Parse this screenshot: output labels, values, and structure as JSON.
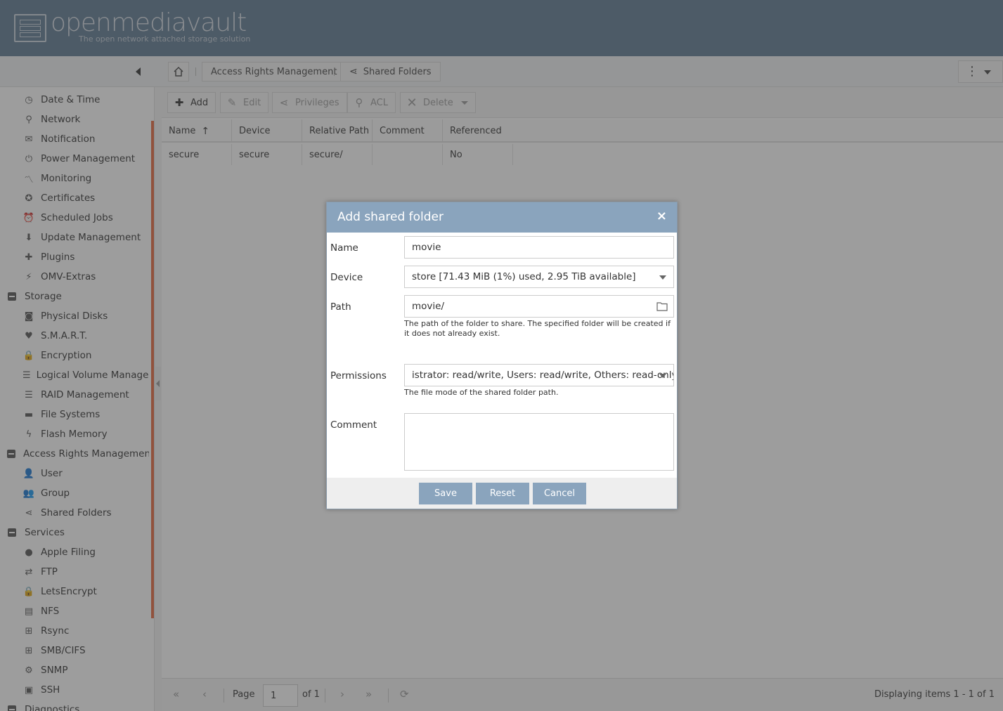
{
  "app": {
    "logo_text": "openmediavault",
    "logo_subtitle": "The open network attached storage solution"
  },
  "breadcrumb": {
    "items": [
      "Access Rights Management",
      "Shared Folders"
    ]
  },
  "sidebar": {
    "items": [
      {
        "label": "Date & Time",
        "icon": "clock-icon",
        "glyph": "◷"
      },
      {
        "label": "Network",
        "icon": "network-icon",
        "glyph": "⚲"
      },
      {
        "label": "Notification",
        "icon": "envelope-icon",
        "glyph": "✉"
      },
      {
        "label": "Power Management",
        "icon": "power-icon",
        "glyph": "⏻"
      },
      {
        "label": "Monitoring",
        "icon": "line-chart-icon",
        "glyph": "〽"
      },
      {
        "label": "Certificates",
        "icon": "certificate-icon",
        "glyph": "✪"
      },
      {
        "label": "Scheduled Jobs",
        "icon": "alarm-icon",
        "glyph": "⏰"
      },
      {
        "label": "Update Management",
        "icon": "download-icon",
        "glyph": "⬇"
      },
      {
        "label": "Plugins",
        "icon": "puzzle-icon",
        "glyph": "✚"
      },
      {
        "label": "OMV-Extras",
        "icon": "plug-icon",
        "glyph": "⚡"
      },
      {
        "label": "Storage",
        "group": true
      },
      {
        "label": "Physical Disks",
        "icon": "disk-icon",
        "glyph": "◙"
      },
      {
        "label": "S.M.A.R.T.",
        "icon": "heartbeat-icon",
        "glyph": "♥"
      },
      {
        "label": "Encryption",
        "icon": "lock-icon",
        "glyph": "🔒"
      },
      {
        "label": "Logical Volume Management",
        "icon": "database-icon",
        "glyph": "☰"
      },
      {
        "label": "RAID Management",
        "icon": "database-icon",
        "glyph": "☰"
      },
      {
        "label": "File Systems",
        "icon": "folder-icon",
        "glyph": "▬"
      },
      {
        "label": "Flash Memory",
        "icon": "bolt-icon",
        "glyph": "ϟ"
      },
      {
        "label": "Access Rights Management",
        "group": true
      },
      {
        "label": "User",
        "icon": "user-icon",
        "glyph": "👤"
      },
      {
        "label": "Group",
        "icon": "users-icon",
        "glyph": "👥"
      },
      {
        "label": "Shared Folders",
        "icon": "share-icon",
        "glyph": "⋖"
      },
      {
        "label": "Services",
        "group": true
      },
      {
        "label": "Apple Filing",
        "icon": "apple-icon",
        "glyph": "●"
      },
      {
        "label": "FTP",
        "icon": "ftp-icon",
        "glyph": "⇄"
      },
      {
        "label": "LetsEncrypt",
        "icon": "lock-icon",
        "glyph": "🔒"
      },
      {
        "label": "NFS",
        "icon": "file-icon",
        "glyph": "▤"
      },
      {
        "label": "Rsync",
        "icon": "sitemap-icon",
        "glyph": "⊞"
      },
      {
        "label": "SMB/CIFS",
        "icon": "windows-icon",
        "glyph": "⊞"
      },
      {
        "label": "SNMP",
        "icon": "snmp-icon",
        "glyph": "⚙"
      },
      {
        "label": "SSH",
        "icon": "terminal-icon",
        "glyph": "▣"
      },
      {
        "label": "Diagnostics",
        "group": true
      }
    ]
  },
  "toolbar": {
    "add": "Add",
    "edit": "Edit",
    "privileges": "Privileges",
    "acl": "ACL",
    "delete": "Delete"
  },
  "grid": {
    "columns": [
      "Name",
      "Device",
      "Relative Path",
      "Comment",
      "Referenced"
    ],
    "rows": [
      {
        "name": "secure",
        "device": "secure",
        "path": "secure/",
        "comment": "",
        "referenced": "No"
      }
    ]
  },
  "pager": {
    "page_label": "Page",
    "page_value": "1",
    "of_label": "of 1",
    "display_text": "Displaying items 1 - 1 of 1"
  },
  "dialog": {
    "title": "Add shared folder",
    "close_glyph": "×",
    "name_label": "Name",
    "name_value": "movie",
    "device_label": "Device",
    "device_value": "store [71.43 MiB (1%) used, 2.95 TiB available]",
    "path_label": "Path",
    "path_value": "movie/",
    "path_hint": "The path of the folder to share. The specified folder will be created if it does not already exist.",
    "permissions_label": "Permissions",
    "permissions_value": "istrator: read/write, Users: read/write, Others: read-only",
    "permissions_hint": "The file mode of the shared folder path.",
    "comment_label": "Comment",
    "comment_value": "",
    "save": "Save",
    "reset": "Reset",
    "cancel": "Cancel"
  },
  "colors": {
    "header": "#5f7a93",
    "dialog_accent": "#8aa4bd",
    "sidebar_scroll": "#e7683e"
  }
}
